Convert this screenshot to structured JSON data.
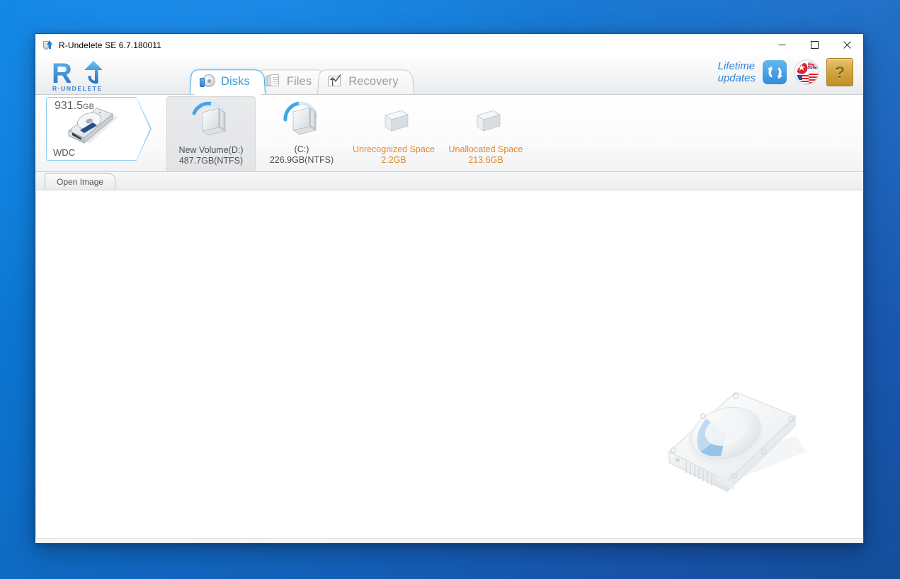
{
  "window": {
    "title": "R-Undelete SE 6.7.180011",
    "app_icon": "undelete-app-icon",
    "minimize_label": "—",
    "maximize_label": "□",
    "close_label": "✕"
  },
  "branding": {
    "logo_letter": "R",
    "logo_wordmark": "R·UNDELETE",
    "logo_arrow_icon": "up-arrow-icon"
  },
  "tabs": [
    {
      "label": "Disks",
      "icon": "disk-icon",
      "active": true
    },
    {
      "label": "Files",
      "icon": "files-icon",
      "active": false
    },
    {
      "label": "Recovery",
      "icon": "recovery-icon",
      "active": false
    }
  ],
  "header_right": {
    "lifetime_line1": "Lifetime",
    "lifetime_line2": "updates",
    "sync_icon": "refresh-sync-icon",
    "language_icon": "flags-globe-icon",
    "help_icon": "help-book-icon",
    "help_glyph": "?"
  },
  "disk": {
    "size": "931.5",
    "size_unit": "GB",
    "vendor": "WDC",
    "icon": "hard-disk-drive-icon"
  },
  "volumes": [
    {
      "name": "New Volume(D:)",
      "info": "487.7GB(NTFS)",
      "icon": "volume-icon",
      "selected": true,
      "free_space": false,
      "usage_arc_percent": 58
    },
    {
      "name": "(C:)",
      "info": "226.9GB(NTFS)",
      "icon": "volume-icon",
      "selected": false,
      "free_space": false,
      "usage_arc_percent": 42
    },
    {
      "name": "Unrecognized Space",
      "info": "2.2GB",
      "icon": "empty-volume-icon",
      "selected": false,
      "free_space": true,
      "usage_arc_percent": 0
    },
    {
      "name": "Unallocated Space",
      "info": "213.6GB",
      "icon": "empty-volume-icon",
      "selected": false,
      "free_space": true,
      "usage_arc_percent": 0
    }
  ],
  "subtabs": [
    {
      "label": "Open Image",
      "active": true
    }
  ],
  "content": {
    "watermark_icon": "hard-disk-watermark-icon"
  },
  "colors": {
    "accent_blue": "#3e9ada",
    "tab_active_border": "#4aa7e8",
    "free_space_orange": "#e08a2e",
    "desktop_blue": "#0d7ad8",
    "help_gold": "#d2a43f"
  }
}
